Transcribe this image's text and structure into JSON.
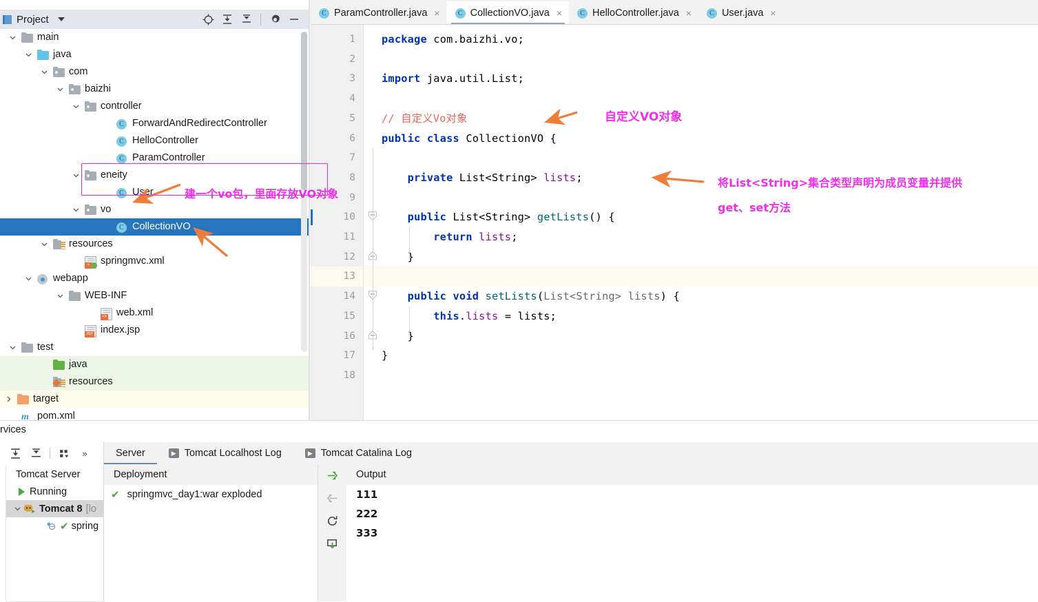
{
  "project_panel": {
    "title": "Project",
    "toolbar_icons": [
      "locate-icon",
      "expand-all-icon",
      "collapse-all-icon",
      "gear-icon",
      "minimize-icon"
    ],
    "tree": [
      {
        "label": "main",
        "indent": 0,
        "expander": "down",
        "icon": "folder-grey",
        "state": "none"
      },
      {
        "label": "java",
        "indent": 1,
        "expander": "down",
        "icon": "folder-blue",
        "state": "none"
      },
      {
        "label": "com",
        "indent": 2,
        "expander": "down",
        "icon": "folder-package",
        "state": "none"
      },
      {
        "label": "baizhi",
        "indent": 3,
        "expander": "down",
        "icon": "folder-package",
        "state": "none"
      },
      {
        "label": "controller",
        "indent": 4,
        "expander": "down",
        "icon": "folder-package",
        "state": "none"
      },
      {
        "label": "ForwardAndRedirectController",
        "indent": 6,
        "expander": "none",
        "icon": "class-icon",
        "state": "none"
      },
      {
        "label": "HelloController",
        "indent": 6,
        "expander": "none",
        "icon": "class-icon",
        "state": "none"
      },
      {
        "label": "ParamController",
        "indent": 6,
        "expander": "none",
        "icon": "class-icon",
        "state": "none"
      },
      {
        "label": "eneity",
        "indent": 4,
        "expander": "down",
        "icon": "folder-package",
        "state": "none"
      },
      {
        "label": "User",
        "indent": 6,
        "expander": "none",
        "icon": "class-icon",
        "state": "none"
      },
      {
        "label": "vo",
        "indent": 4,
        "expander": "down",
        "icon": "folder-package",
        "state": "none"
      },
      {
        "label": "CollectionVO",
        "indent": 6,
        "expander": "none",
        "icon": "class-icon",
        "state": "selected"
      },
      {
        "label": "resources",
        "indent": 2,
        "expander": "down",
        "icon": "folder-resource",
        "state": "none"
      },
      {
        "label": "springmvc.xml",
        "indent": 4,
        "expander": "none",
        "icon": "xml-spring-icon",
        "state": "none"
      },
      {
        "label": "webapp",
        "indent": 1,
        "expander": "down",
        "icon": "folder-web",
        "state": "none"
      },
      {
        "label": "WEB-INF",
        "indent": 3,
        "expander": "down",
        "icon": "folder-grey",
        "state": "none"
      },
      {
        "label": "web.xml",
        "indent": 5,
        "expander": "none",
        "icon": "xml-icon",
        "state": "none"
      },
      {
        "label": "index.jsp",
        "indent": 4,
        "expander": "none",
        "icon": "jsp-icon",
        "state": "none"
      },
      {
        "label": "test",
        "indent": 0,
        "expander": "down",
        "icon": "folder-grey",
        "state": "none"
      },
      {
        "label": "java",
        "indent": 2,
        "expander": "none",
        "icon": "folder-green",
        "state": "green"
      },
      {
        "label": "resources",
        "indent": 2,
        "expander": "none",
        "icon": "folder-testres",
        "state": "green"
      },
      {
        "label": "target",
        "indent": -1,
        "expander": "right",
        "icon": "folder-orange",
        "state": "yellow"
      },
      {
        "label": "pom.xml",
        "indent": 0,
        "expander": "none",
        "icon": "maven-icon",
        "state": "none"
      }
    ]
  },
  "editor": {
    "tabs": [
      {
        "label": "ParamController.java",
        "icon": "class-icon",
        "active": false,
        "close": "×"
      },
      {
        "label": "CollectionVO.java",
        "icon": "class-icon",
        "active": true,
        "close": "×"
      },
      {
        "label": "HelloController.java",
        "icon": "class-icon",
        "active": false,
        "close": "×"
      },
      {
        "label": "User.java",
        "icon": "class-icon",
        "active": false,
        "close": "×"
      }
    ],
    "line_numbers": [
      "1",
      "2",
      "3",
      "4",
      "5",
      "6",
      "7",
      "8",
      "9",
      "10",
      "11",
      "12",
      "13",
      "14",
      "15",
      "16",
      "17",
      "18"
    ],
    "current_line": 13,
    "code_lines": [
      {
        "n": 1,
        "tokens": [
          {
            "t": "package ",
            "c": "kw"
          },
          {
            "t": "com.baizhi.vo;",
            "c": "id"
          }
        ]
      },
      {
        "n": 2,
        "tokens": []
      },
      {
        "n": 3,
        "tokens": [
          {
            "t": "import ",
            "c": "kw"
          },
          {
            "t": "java.util.List;",
            "c": "id"
          }
        ]
      },
      {
        "n": 4,
        "tokens": []
      },
      {
        "n": 5,
        "tokens": [
          {
            "t": "// 自定义Vo对象",
            "c": "cmt"
          }
        ]
      },
      {
        "n": 6,
        "tokens": [
          {
            "t": "public class ",
            "c": "kw"
          },
          {
            "t": "CollectionVO {",
            "c": "id"
          }
        ]
      },
      {
        "n": 7,
        "tokens": []
      },
      {
        "n": 8,
        "tokens": [
          {
            "t": "    private ",
            "c": "kw"
          },
          {
            "t": "List<String> ",
            "c": "id"
          },
          {
            "t": "lists",
            "c": "fld"
          },
          {
            "t": ";",
            "c": "pun"
          }
        ]
      },
      {
        "n": 9,
        "tokens": []
      },
      {
        "n": 10,
        "tokens": [
          {
            "t": "    public ",
            "c": "kw"
          },
          {
            "t": "List<String> ",
            "c": "id"
          },
          {
            "t": "getLists",
            "c": "mth"
          },
          {
            "t": "() {",
            "c": "pun"
          }
        ]
      },
      {
        "n": 11,
        "tokens": [
          {
            "t": "        return ",
            "c": "kw"
          },
          {
            "t": "lists",
            "c": "fld"
          },
          {
            "t": ";",
            "c": "pun"
          }
        ]
      },
      {
        "n": 12,
        "tokens": [
          {
            "t": "    }",
            "c": "pun"
          }
        ]
      },
      {
        "n": 13,
        "tokens": []
      },
      {
        "n": 14,
        "tokens": [
          {
            "t": "    public void ",
            "c": "kw"
          },
          {
            "t": "setLists",
            "c": "mth"
          },
          {
            "t": "(",
            "c": "pun"
          },
          {
            "t": "List<String> lists",
            "c": "prm"
          },
          {
            "t": ") {",
            "c": "pun"
          }
        ]
      },
      {
        "n": 15,
        "tokens": [
          {
            "t": "        this",
            "c": "kw"
          },
          {
            "t": ".",
            "c": "pun"
          },
          {
            "t": "lists",
            "c": "fld"
          },
          {
            "t": " = lists;",
            "c": "pun"
          }
        ]
      },
      {
        "n": 16,
        "tokens": [
          {
            "t": "    }",
            "c": "pun"
          }
        ]
      },
      {
        "n": 17,
        "tokens": [
          {
            "t": "}",
            "c": "pun"
          }
        ]
      },
      {
        "n": 18,
        "tokens": []
      }
    ]
  },
  "annotations": {
    "color": "#ef2fef",
    "arrow_color": "#ef7d3a",
    "box_color": "#e22ee2",
    "items": [
      {
        "name": "anno-vo-package",
        "text": "建一个vo包，里面存放VO对象"
      },
      {
        "name": "anno-custom-vo",
        "text": "自定义VO对象"
      },
      {
        "name": "anno-list-field-1",
        "text": "将List<String>集合类型声明为成员变量并提供"
      },
      {
        "name": "anno-list-field-2",
        "text": "get、set方法"
      }
    ]
  },
  "services": {
    "window_label": "rvices",
    "toolbar_icons": [
      "expand-all-icon",
      "collapse-all-icon",
      "group-icon",
      "more-icon"
    ],
    "more_label": "»",
    "tree": [
      {
        "label": "Tomcat Server",
        "type": "root",
        "expander": "none",
        "selected": false
      },
      {
        "label": "Running",
        "type": "status",
        "expander": "none",
        "selected": false
      },
      {
        "label": "Tomcat 8",
        "suffix": "[lo",
        "type": "server",
        "expander": "down",
        "selected": true
      },
      {
        "label": "spring",
        "type": "artifact",
        "expander": "none",
        "selected": false
      }
    ],
    "tabs": [
      {
        "label": "Server",
        "icon": "none",
        "active": true
      },
      {
        "label": "Tomcat Localhost Log",
        "icon": "play-icon",
        "active": false
      },
      {
        "label": "Tomcat Catalina Log",
        "icon": "play-icon",
        "active": false
      }
    ],
    "deployment": {
      "header": "Deployment",
      "rows": [
        {
          "label": "springmvc_day1:war exploded",
          "status": "ok"
        }
      ],
      "action_icons": [
        "deploy-icon",
        "undeploy-icon",
        "redeploy-icon",
        "download-icon"
      ]
    },
    "output": {
      "header": "Output",
      "lines": [
        "111",
        "222",
        "333"
      ]
    }
  }
}
